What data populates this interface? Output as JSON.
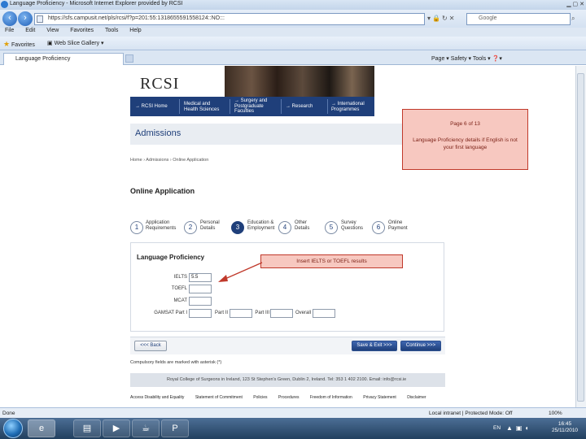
{
  "browser": {
    "window_title": "Language Proficiency - Microsoft Internet Explorer provided by RCSI",
    "address": "https://sfs.campusit.net/pls/rcsi/f?p=201:55:1318655591558124::NO:::",
    "search_placeholder": "Google",
    "menu": [
      "File",
      "Edit",
      "View",
      "Favorites",
      "Tools",
      "Help"
    ],
    "favorites_label": "Favorites",
    "web_slice_label": "Web Slice Gallery ▾",
    "tab_label": "Language Proficiency",
    "command_bar": "Page ▾   Safety ▾   Tools ▾   ❓▾",
    "status_left": "Done",
    "status_zone": "Local intranet | Protected Mode: Off",
    "status_zoom": "100%"
  },
  "site": {
    "logo": "RCSI",
    "nav": [
      {
        "label": "→ RCSI Home"
      },
      {
        "label": "Medical and\nHealth Sciences"
      },
      {
        "label": "→ Surgery and\nPostgraduate\nFaculties"
      },
      {
        "label": "→ Research"
      },
      {
        "label": "→ International\nProgrammes"
      }
    ],
    "section_title": "Admissions",
    "breadcrumb": "Home › Admissions › Online Application",
    "page_title": "Online Application"
  },
  "steps": [
    {
      "number": "1",
      "label": "Application\nRequirements",
      "active": false
    },
    {
      "number": "2",
      "label": "Personal\nDetails",
      "active": false
    },
    {
      "number": "3",
      "label": "Education &\nEmployment",
      "active": true
    },
    {
      "number": "4",
      "label": "Other\nDetails",
      "active": false
    },
    {
      "number": "5",
      "label": "Survey\nQuestions",
      "active": false
    },
    {
      "number": "6",
      "label": "Online\nPayment",
      "active": false
    }
  ],
  "form": {
    "title": "Language Proficiency",
    "fields": {
      "ielts_label": "IELTS",
      "ielts_value": "5.5",
      "toefl_label": "TOEFL",
      "mcat_label": "MCAT",
      "gamsat_label": "GAMSAT Part I",
      "part2_label": "Part II",
      "part3_label": "Part III",
      "overall_label": "Overall"
    },
    "back_button": "<<< Back",
    "save_exit_button": "Save & Exit >>>",
    "continue_button": "Continue >>>",
    "compulsory_note": "Compulsory fields are marked with asterisk (*)"
  },
  "footer": {
    "address": "Royal College of Surgeons in Ireland, 123 St Stephen's Green, Dublin 2, Ireland. Tel: 353 1 402 2100. Email: info@rcsi.ie",
    "links": [
      "Access Disability and Equality",
      "Statement of Commitment",
      "Policies",
      "Procedures",
      "Freedom of Information",
      "Privacy Statement",
      "Disclaimer"
    ]
  },
  "annotations": {
    "page_indicator": "Page 6 of 13",
    "page_description": "Language Proficiency details if English is not your first language",
    "insert_hint": "Insert IELTS or TOEFL results"
  },
  "taskbar": {
    "language": "EN",
    "time": "16:45",
    "date": "25/11/2010"
  },
  "colors": {
    "rcsi_blue": "#1f3f7a",
    "callout_fill": "#f7c8c0",
    "callout_border": "#c0392b",
    "arrow": "#c0392b"
  }
}
